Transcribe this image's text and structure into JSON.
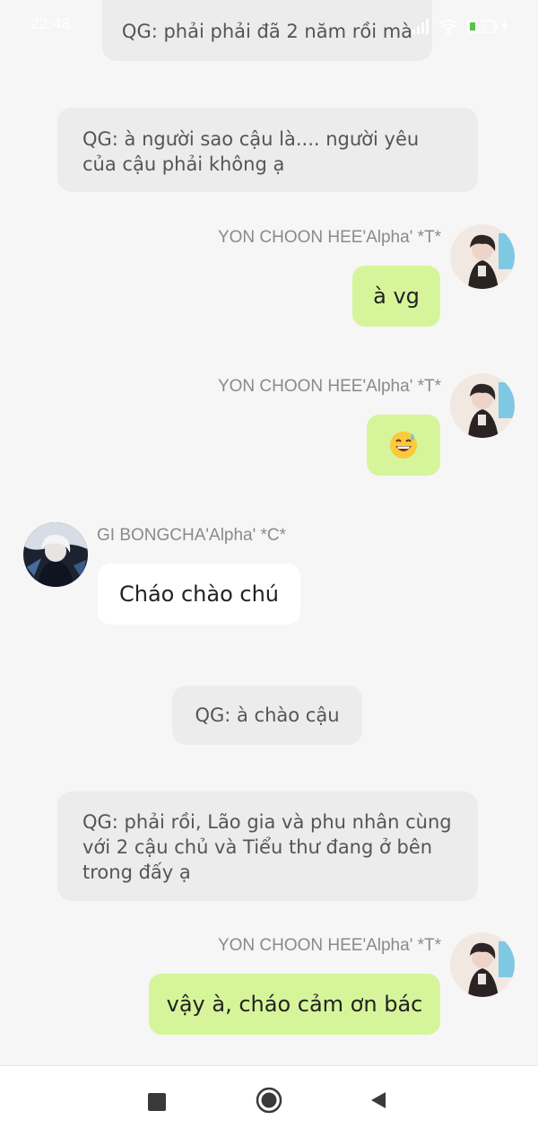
{
  "status_bar": {
    "time": "22:48",
    "icons": [
      "signal-icon",
      "wifi-icon",
      "battery-icon",
      "charging-icon"
    ],
    "battery_level": "24"
  },
  "messages": [
    {
      "kind": "narration",
      "text": "QG: phải phải đã 2 năm rồi mà"
    },
    {
      "kind": "narration",
      "text": "QG: à người sao cậu là.... người yêu của cậu phải không ạ"
    },
    {
      "kind": "outgoing",
      "sender": "YON CHOON HEE'Alpha' *T*",
      "text": "à vg"
    },
    {
      "kind": "outgoing",
      "sender": "YON CHOON HEE'Alpha' *T*",
      "text": "😅"
    },
    {
      "kind": "incoming",
      "sender": "GI BONGCHA'Alpha' *C*",
      "text": "Cháo chào chú"
    },
    {
      "kind": "narration",
      "text": "QG: à chào cậu"
    },
    {
      "kind": "narration",
      "text": "QG: phải rồi, Lão gia và phu nhân cùng với 2 cậu chủ và Tiểu thư đang ở bên trong đấy ạ"
    },
    {
      "kind": "outgoing",
      "sender": "YON CHOON HEE'Alpha' *T*",
      "text": "vậy à, cháo cảm ơn bác"
    }
  ],
  "nav_bar": {
    "buttons": [
      "recents-square-icon",
      "home-circle-icon",
      "back-triangle-icon"
    ]
  },
  "colors": {
    "background": "#f6f6f6",
    "narration_bubble": "#ececec",
    "outgoing_bubble": "#d6f59a",
    "incoming_bubble": "#ffffff",
    "sender_name": "#8a8a8a"
  }
}
